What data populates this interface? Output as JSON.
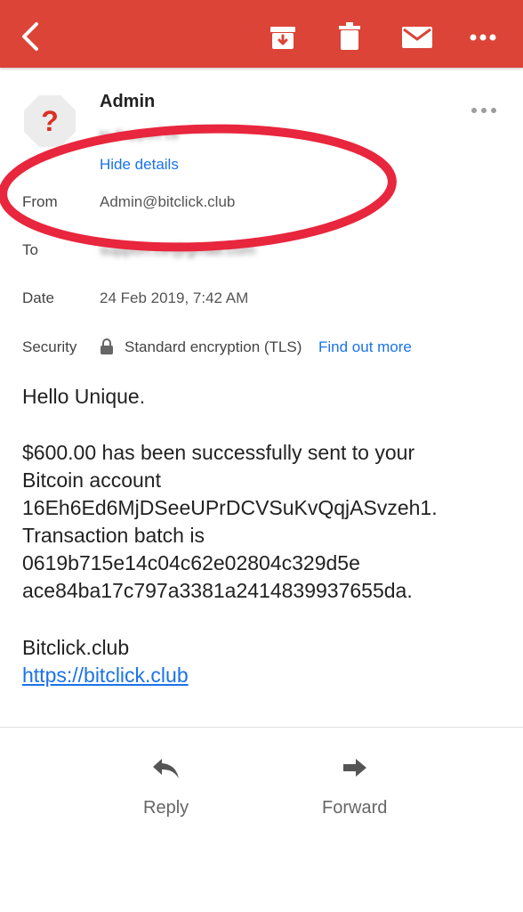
{
  "toolbar": {
    "back_icon": "back-arrow-icon",
    "archive_icon": "archive-icon",
    "delete_icon": "trash-icon",
    "mark_unread_icon": "envelope-icon",
    "more_icon": "more-dots-icon",
    "color": "#db4437"
  },
  "message": {
    "sender_name": "Admin",
    "recipient_summary": "to Support ctr",
    "hide_details": "Hide details",
    "details": {
      "from_label": "From",
      "from_value": "Admin@bitclick.club",
      "to_label": "To",
      "to_value": "support.ctr@gmail.com",
      "date_label": "Date",
      "date_value": "24 Feb 2019, 7:42 AM",
      "security_label": "Security",
      "security_value": "Standard encryption (TLS)",
      "find_out_more": "Find out more"
    },
    "body": {
      "greeting": "Hello Unique.",
      "line1": "$600.00 has been successfully sent to your",
      "line2": "Bitcoin account",
      "line3": "16Eh6Ed6MjDSeeUPrDCVSuKvQqjASvzeh1.",
      "line4": "Transaction batch is",
      "line5": "0619b715e14c04c62e02804c329d5e",
      "line6": "ace84ba17c797a3381a2414839937655da.",
      "signature": "Bitclick.club",
      "link": "https://bitclick.club"
    }
  },
  "actions": {
    "reply": "Reply",
    "forward": "Forward"
  },
  "annotation_color": "#e8263d",
  "link_color": "#1a73e8"
}
